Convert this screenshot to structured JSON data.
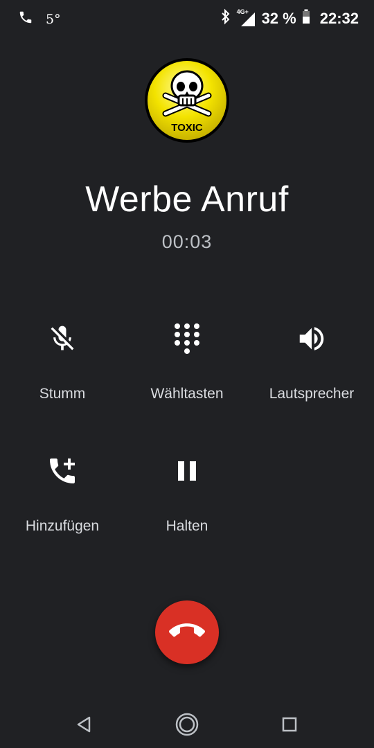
{
  "status_bar": {
    "temperature": "5°",
    "network": "4G+",
    "battery": "32 %",
    "time": "22:32",
    "icons": [
      "phone-icon",
      "bluetooth-icon",
      "signal-icon",
      "battery-icon"
    ]
  },
  "caller": {
    "avatar_text": "TOXIC",
    "name": "Werbe Anruf",
    "duration": "00:03"
  },
  "controls": {
    "mute": {
      "label": "Stumm",
      "icon": "mic-off-icon"
    },
    "keypad": {
      "label": "Wähltasten",
      "icon": "dialpad-icon"
    },
    "speaker": {
      "label": "Lautsprecher",
      "icon": "volume-icon"
    },
    "add_call": {
      "label": "Hinzufügen",
      "icon": "add-call-icon"
    },
    "hold": {
      "label": "Halten",
      "icon": "pause-icon"
    }
  },
  "end_call": {
    "icon": "hang-up-icon",
    "color": "#d93025"
  },
  "colors": {
    "background": "#202124",
    "end_call": "#d93025",
    "avatar_yellow": "#f5e400"
  }
}
